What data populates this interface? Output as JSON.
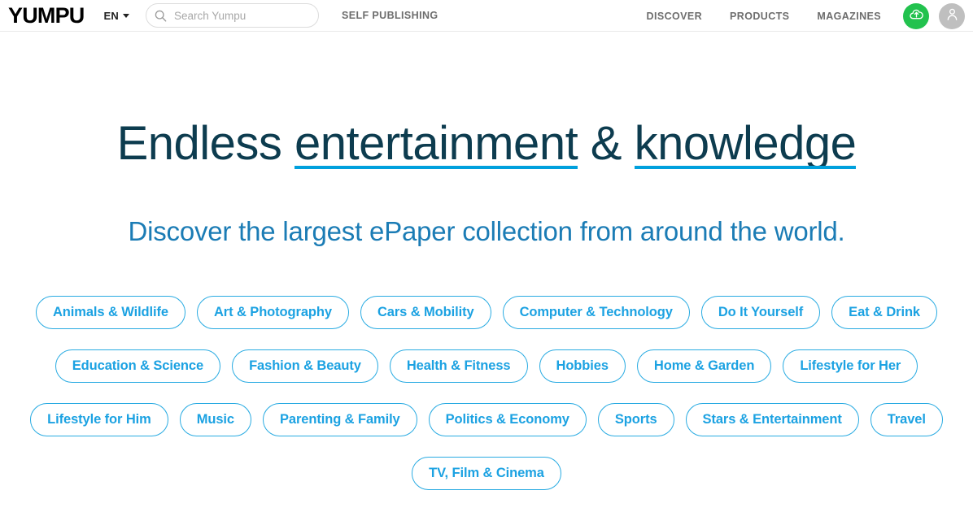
{
  "header": {
    "logo": "YUMPU",
    "language": {
      "label": "EN",
      "caret_icon": "chevron-down-icon"
    },
    "search": {
      "placeholder": "Search Yumpu",
      "value": "",
      "icon": "search-icon"
    },
    "self_publishing": "SELF PUBLISHING",
    "nav": [
      {
        "label": "DISCOVER"
      },
      {
        "label": "PRODUCTS"
      },
      {
        "label": "MAGAZINES"
      }
    ],
    "upload_button": {
      "icon": "cloud-upload-icon",
      "color": "#22c24e"
    },
    "account_button": {
      "icon": "user-avatar-icon",
      "color": "#bfbfbf"
    }
  },
  "hero": {
    "title_part1": "Endless ",
    "title_underlined1": "entertainment",
    "title_part2": " & ",
    "title_underlined2": "knowledge",
    "subtitle": "Discover the largest ePaper collection from around the world.",
    "title_color": "#0d3c4f",
    "underline_color": "#00a0dd",
    "subtitle_color": "#1b7cb5"
  },
  "categories": {
    "accent_color": "#29abe2",
    "rows": [
      [
        {
          "label": "Animals & Wildlife"
        },
        {
          "label": "Art & Photography"
        },
        {
          "label": "Cars & Mobility"
        },
        {
          "label": "Computer & Technology"
        },
        {
          "label": "Do It Yourself"
        },
        {
          "label": "Eat & Drink"
        }
      ],
      [
        {
          "label": "Education & Science"
        },
        {
          "label": "Fashion & Beauty"
        },
        {
          "label": "Health & Fitness"
        },
        {
          "label": "Hobbies"
        },
        {
          "label": "Home & Garden"
        },
        {
          "label": "Lifestyle for Her"
        }
      ],
      [
        {
          "label": "Lifestyle for Him"
        },
        {
          "label": "Music"
        },
        {
          "label": "Parenting & Family"
        },
        {
          "label": "Politics & Economy"
        },
        {
          "label": "Sports"
        },
        {
          "label": "Stars & Entertainment"
        },
        {
          "label": "Travel"
        }
      ],
      [
        {
          "label": "TV, Film & Cinema"
        }
      ]
    ]
  }
}
